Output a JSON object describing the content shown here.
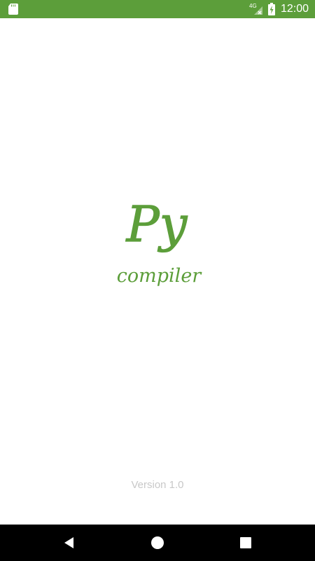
{
  "status_bar": {
    "background": "#5c9e3a",
    "network_label": "4G",
    "time": "12:00",
    "icons": [
      "sd-card-icon",
      "cell-signal-icon",
      "battery-charging-icon"
    ]
  },
  "logo": {
    "title": "Py",
    "subtitle": "compiler",
    "color": "#5c9e3a"
  },
  "version": "Version 1.0",
  "nav_bar": {
    "icons": [
      "back-icon",
      "home-icon",
      "recents-icon"
    ]
  }
}
